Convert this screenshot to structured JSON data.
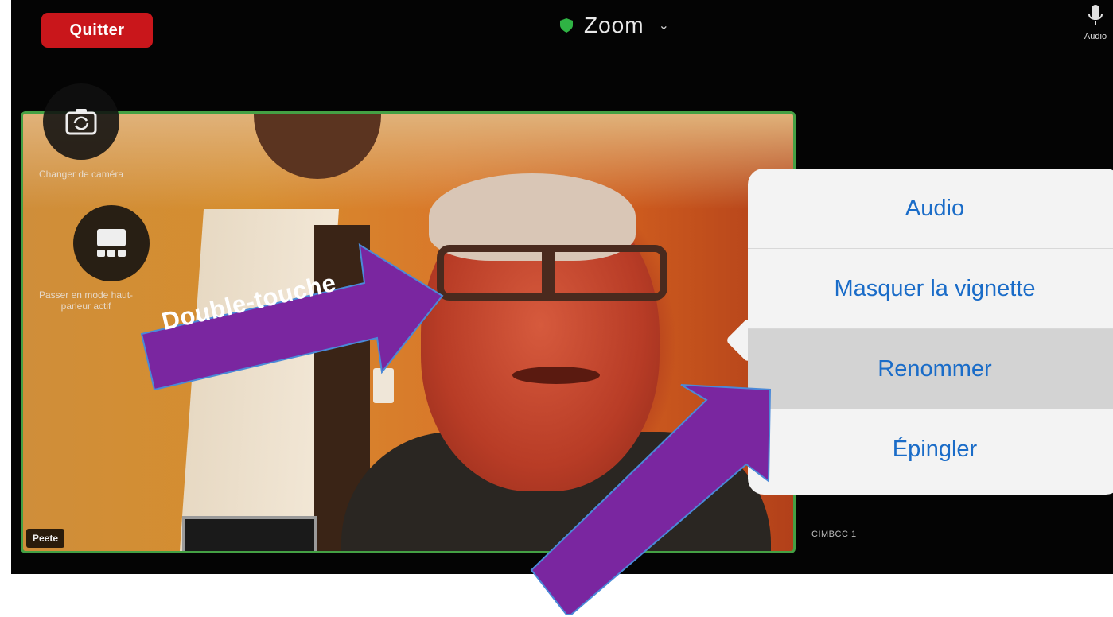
{
  "window": {
    "title": "Zoom",
    "quit_label": "Quitter",
    "audio_label": "Audio"
  },
  "controls": {
    "switch_camera_label": "Changer de caméra",
    "speaker_mode_label": "Passer en mode haut-parleur actif"
  },
  "video": {
    "participant_name": "Peete",
    "side_label": "CIMBCC 1"
  },
  "context_menu": {
    "items": [
      {
        "label": "Audio"
      },
      {
        "label": "Masquer la vignette"
      },
      {
        "label": "Renommer",
        "highlighted": true
      },
      {
        "label": "Épingler"
      }
    ]
  },
  "annotation": {
    "text": "Double-touche",
    "arrow_color": "#7a26a0"
  },
  "colors": {
    "quit_red": "#c9161b",
    "menu_text_blue": "#1a6cc8",
    "tile_border": "#44a044"
  }
}
